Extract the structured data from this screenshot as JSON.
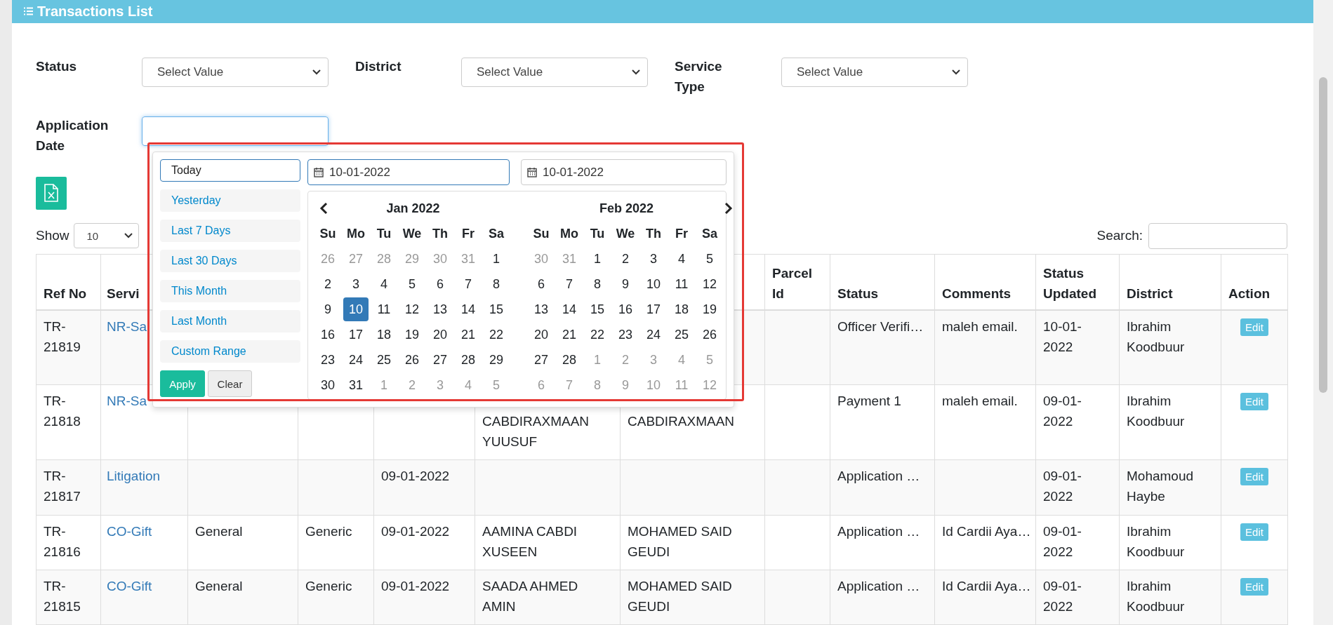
{
  "header": {
    "title": "Transactions List"
  },
  "filters": [
    {
      "label": "Status",
      "value": "Select Value"
    },
    {
      "label": "District",
      "value": "Select Value"
    },
    {
      "label": "Service Type",
      "value": "Select Value"
    }
  ],
  "application_date": {
    "label": "Application Date",
    "focused": true
  },
  "length_menu": {
    "label": "Show",
    "value": "10"
  },
  "search": {
    "label": "Search:"
  },
  "table": {
    "columns": [
      "Ref No",
      "Servi",
      null,
      null,
      null,
      null,
      null,
      "Parcel Id",
      "Status",
      "Comments",
      "Status Updated",
      "District",
      "Action"
    ],
    "rows": [
      {
        "cells": [
          "TR-21819",
          "NR-Sa",
          null,
          null,
          null,
          null,
          null,
          null,
          "Officer Verifi…",
          "maleh email.",
          "10-01-2022",
          "Ibrahim Koodbuur",
          "Edit"
        ]
      },
      {
        "cells": [
          "TR-21818",
          "NR-Sa",
          null,
          null,
          null,
          "CABDIRAXMAAN YUUSUF",
          "CABDIRAXMAAN",
          null,
          "Payment 1",
          "maleh email.",
          "09-01-2022",
          "Ibrahim Koodbuur",
          "Edit"
        ]
      },
      {
        "cells": [
          "TR-21817",
          "Litigation",
          null,
          null,
          "09-01-2022",
          null,
          null,
          null,
          "Application …",
          null,
          "09-01-2022",
          "Mohamoud Haybe",
          "Edit"
        ]
      },
      {
        "cells": [
          "TR-21816",
          "CO-Gift",
          "General",
          "Generic",
          "09-01-2022",
          "AAMINA CABDI XUSEEN",
          "MOHAMED SAID GEUDI",
          null,
          "Application …",
          "Id Cardii Aya…",
          "09-01-2022",
          "Ibrahim Koodbuur",
          "Edit"
        ]
      },
      {
        "cells": [
          "TR-21815",
          "CO-Gift",
          "General",
          "Generic",
          "09-01-2022",
          "SAADA AHMED AMIN",
          "MOHAMED SAID GEUDI",
          null,
          "Application …",
          "Id Cardii Aya…",
          "09-01-2022",
          "Ibrahim Koodbuur",
          "Edit"
        ]
      }
    ]
  },
  "date_picker": {
    "ranges": [
      {
        "label": "Today",
        "selected": true
      },
      {
        "label": "Yesterday",
        "selected": false
      },
      {
        "label": "Last 7 Days",
        "selected": false
      },
      {
        "label": "Last 30 Days",
        "selected": false
      },
      {
        "label": "This Month",
        "selected": false
      },
      {
        "label": "Last Month",
        "selected": false
      },
      {
        "label": "Custom Range",
        "selected": false
      }
    ],
    "apply": "Apply",
    "clear": "Clear",
    "start": {
      "value": "10-01-2022",
      "focused": true
    },
    "end": {
      "value": "10-01-2022",
      "focused": false
    },
    "months": [
      {
        "title": "Jan 2022",
        "weekdays": [
          "Su",
          "Mo",
          "Tu",
          "We",
          "Th",
          "Fr",
          "Sa"
        ],
        "days": [
          {
            "day": "26",
            "muted": true,
            "selected": false
          },
          {
            "day": "27",
            "muted": true,
            "selected": false
          },
          {
            "day": "28",
            "muted": true,
            "selected": false
          },
          {
            "day": "29",
            "muted": true,
            "selected": false
          },
          {
            "day": "30",
            "muted": true,
            "selected": false
          },
          {
            "day": "31",
            "muted": true,
            "selected": false
          },
          {
            "day": "1",
            "muted": false,
            "selected": false
          },
          {
            "day": "2",
            "muted": false,
            "selected": false
          },
          {
            "day": "3",
            "muted": false,
            "selected": false
          },
          {
            "day": "4",
            "muted": false,
            "selected": false
          },
          {
            "day": "5",
            "muted": false,
            "selected": false
          },
          {
            "day": "6",
            "muted": false,
            "selected": false
          },
          {
            "day": "7",
            "muted": false,
            "selected": false
          },
          {
            "day": "8",
            "muted": false,
            "selected": false
          },
          {
            "day": "9",
            "muted": false,
            "selected": false
          },
          {
            "day": "10",
            "muted": false,
            "selected": true
          },
          {
            "day": "11",
            "muted": false,
            "selected": false
          },
          {
            "day": "12",
            "muted": false,
            "selected": false
          },
          {
            "day": "13",
            "muted": false,
            "selected": false
          },
          {
            "day": "14",
            "muted": false,
            "selected": false
          },
          {
            "day": "15",
            "muted": false,
            "selected": false
          },
          {
            "day": "16",
            "muted": false,
            "selected": false
          },
          {
            "day": "17",
            "muted": false,
            "selected": false
          },
          {
            "day": "18",
            "muted": false,
            "selected": false
          },
          {
            "day": "19",
            "muted": false,
            "selected": false
          },
          {
            "day": "20",
            "muted": false,
            "selected": false
          },
          {
            "day": "21",
            "muted": false,
            "selected": false
          },
          {
            "day": "22",
            "muted": false,
            "selected": false
          },
          {
            "day": "23",
            "muted": false,
            "selected": false
          },
          {
            "day": "24",
            "muted": false,
            "selected": false
          },
          {
            "day": "25",
            "muted": false,
            "selected": false
          },
          {
            "day": "26",
            "muted": false,
            "selected": false
          },
          {
            "day": "27",
            "muted": false,
            "selected": false
          },
          {
            "day": "28",
            "muted": false,
            "selected": false
          },
          {
            "day": "29",
            "muted": false,
            "selected": false
          },
          {
            "day": "30",
            "muted": false,
            "selected": false
          },
          {
            "day": "31",
            "muted": false,
            "selected": false
          },
          {
            "day": "1",
            "muted": true,
            "selected": false
          },
          {
            "day": "2",
            "muted": true,
            "selected": false
          },
          {
            "day": "3",
            "muted": true,
            "selected": false
          },
          {
            "day": "4",
            "muted": true,
            "selected": false
          },
          {
            "day": "5",
            "muted": true,
            "selected": false
          }
        ]
      },
      {
        "title": "Feb 2022",
        "weekdays": [
          "Su",
          "Mo",
          "Tu",
          "We",
          "Th",
          "Fr",
          "Sa"
        ],
        "days": [
          {
            "day": "30",
            "muted": true,
            "selected": false
          },
          {
            "day": "31",
            "muted": true,
            "selected": false
          },
          {
            "day": "1",
            "muted": false,
            "selected": false
          },
          {
            "day": "2",
            "muted": false,
            "selected": false
          },
          {
            "day": "3",
            "muted": false,
            "selected": false
          },
          {
            "day": "4",
            "muted": false,
            "selected": false
          },
          {
            "day": "5",
            "muted": false,
            "selected": false
          },
          {
            "day": "6",
            "muted": false,
            "selected": false
          },
          {
            "day": "7",
            "muted": false,
            "selected": false
          },
          {
            "day": "8",
            "muted": false,
            "selected": false
          },
          {
            "day": "9",
            "muted": false,
            "selected": false
          },
          {
            "day": "10",
            "muted": false,
            "selected": false
          },
          {
            "day": "11",
            "muted": false,
            "selected": false
          },
          {
            "day": "12",
            "muted": false,
            "selected": false
          },
          {
            "day": "13",
            "muted": false,
            "selected": false
          },
          {
            "day": "14",
            "muted": false,
            "selected": false
          },
          {
            "day": "15",
            "muted": false,
            "selected": false
          },
          {
            "day": "16",
            "muted": false,
            "selected": false
          },
          {
            "day": "17",
            "muted": false,
            "selected": false
          },
          {
            "day": "18",
            "muted": false,
            "selected": false
          },
          {
            "day": "19",
            "muted": false,
            "selected": false
          },
          {
            "day": "20",
            "muted": false,
            "selected": false
          },
          {
            "day": "21",
            "muted": false,
            "selected": false
          },
          {
            "day": "22",
            "muted": false,
            "selected": false
          },
          {
            "day": "23",
            "muted": false,
            "selected": false
          },
          {
            "day": "24",
            "muted": false,
            "selected": false
          },
          {
            "day": "25",
            "muted": false,
            "selected": false
          },
          {
            "day": "26",
            "muted": false,
            "selected": false
          },
          {
            "day": "27",
            "muted": false,
            "selected": false
          },
          {
            "day": "28",
            "muted": false,
            "selected": false
          },
          {
            "day": "1",
            "muted": true,
            "selected": false
          },
          {
            "day": "2",
            "muted": true,
            "selected": false
          },
          {
            "day": "3",
            "muted": true,
            "selected": false
          },
          {
            "day": "4",
            "muted": true,
            "selected": false
          },
          {
            "day": "5",
            "muted": true,
            "selected": false
          },
          {
            "day": "6",
            "muted": true,
            "selected": false
          },
          {
            "day": "7",
            "muted": true,
            "selected": false
          },
          {
            "day": "8",
            "muted": true,
            "selected": false
          },
          {
            "day": "9",
            "muted": true,
            "selected": false
          },
          {
            "day": "10",
            "muted": true,
            "selected": false
          },
          {
            "day": "11",
            "muted": true,
            "selected": false
          },
          {
            "day": "12",
            "muted": true,
            "selected": false
          }
        ]
      }
    ]
  }
}
